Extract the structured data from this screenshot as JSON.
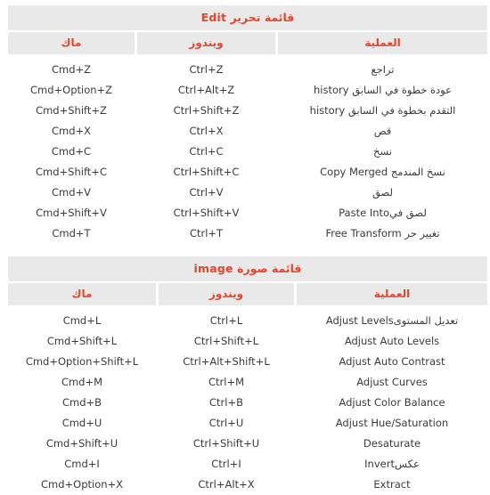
{
  "theme": {
    "page_background": "#ffffff",
    "header_background": "#e9e9e9",
    "header_text_color": "#e8432b",
    "body_text_color": "#3a3a3a"
  },
  "tables": [
    {
      "id": "edit-menu",
      "title": "قائمة تحرير Edit",
      "columns": [
        {
          "key": "mac",
          "label": "ماك"
        },
        {
          "key": "windows",
          "label": "ويندوز"
        },
        {
          "key": "operation",
          "label": "العملية"
        }
      ],
      "rows": [
        {
          "mac": "Cmd+Z",
          "windows": "Ctrl+Z",
          "operation": "تراجع"
        },
        {
          "mac": "Cmd+Option+Z",
          "windows": "Ctrl+Alt+Z",
          "operation": "عودة خطوة في السابق history"
        },
        {
          "mac": "Cmd+Shift+Z",
          "windows": "Ctrl+Shift+Z",
          "operation": "التقدم بخطوة في السابق history"
        },
        {
          "mac": "Cmd+X",
          "windows": "Ctrl+X",
          "operation": "قص"
        },
        {
          "mac": "Cmd+C",
          "windows": "Ctrl+C",
          "operation": "نسخ"
        },
        {
          "mac": "Cmd+Shift+C",
          "windows": "Ctrl+Shift+C",
          "operation": "نسخ المندمج Copy Merged"
        },
        {
          "mac": "Cmd+V",
          "windows": "Ctrl+V",
          "operation": "لصق"
        },
        {
          "mac": "Cmd+Shift+V",
          "windows": "Ctrl+Shift+V",
          "operation": "لصق فيPaste Into"
        },
        {
          "mac": "Cmd+T",
          "windows": "Ctrl+T",
          "operation": "تغيير حر Free Transform"
        }
      ]
    },
    {
      "id": "image-menu",
      "title": "قائمة صورة image",
      "columns": [
        {
          "key": "mac",
          "label": "ماك"
        },
        {
          "key": "windows",
          "label": "ويندوز"
        },
        {
          "key": "operation",
          "label": "العملية"
        }
      ],
      "rows": [
        {
          "mac": "Cmd+L",
          "windows": "Ctrl+L",
          "operation": "تعديل المستوىAdjust Levels"
        },
        {
          "mac": "Cmd+Shift+L",
          "windows": "Ctrl+Shift+L",
          "operation": "Adjust Auto Levels"
        },
        {
          "mac": "Cmd+Option+Shift+L",
          "windows": "Ctrl+Alt+Shift+L",
          "operation": "Adjust Auto Contrast"
        },
        {
          "mac": "Cmd+M",
          "windows": "Ctrl+M",
          "operation": "Adjust Curves"
        },
        {
          "mac": "Cmd+B",
          "windows": "Ctrl+B",
          "operation": "Adjust Color Balance"
        },
        {
          "mac": "Cmd+U",
          "windows": "Ctrl+U",
          "operation": "Adjust Hue/Saturation"
        },
        {
          "mac": "Cmd+Shift+U",
          "windows": "Ctrl+Shift+U",
          "operation": "Desaturate"
        },
        {
          "mac": "Cmd+I",
          "windows": "Ctrl+I",
          "operation": "عكسInvert"
        },
        {
          "mac": "Cmd+Option+X",
          "windows": "Ctrl+Alt+X",
          "operation": "Extract"
        }
      ]
    }
  ]
}
